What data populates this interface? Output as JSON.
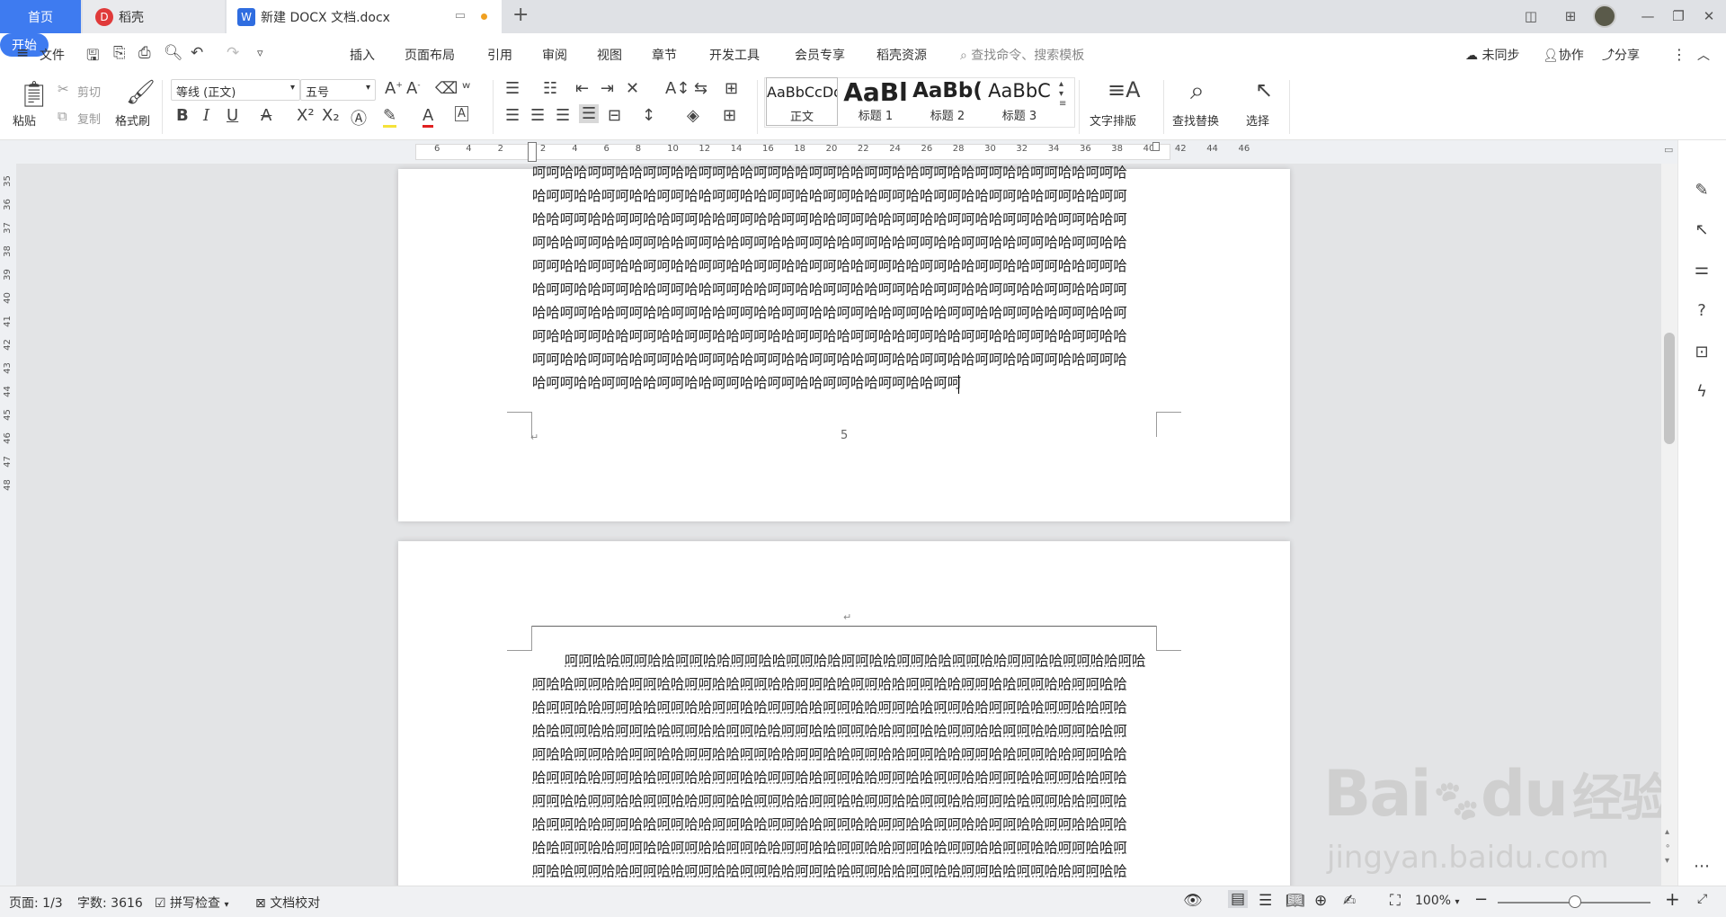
{
  "tabs": {
    "home": "首页",
    "daoke": "稻壳",
    "doc": "新建 DOCX 文档.docx",
    "add": "+"
  },
  "menu": {
    "file": "文件",
    "items": [
      "开始",
      "插入",
      "页面布局",
      "引用",
      "审阅",
      "视图",
      "章节",
      "开发工具",
      "会员专享",
      "稻壳资源"
    ],
    "search_placeholder": "查找命令、搜索模板",
    "sync": "未同步",
    "collab": "协作",
    "share": "分享"
  },
  "ribbon": {
    "paste": "粘贴",
    "cut": "剪切",
    "copy": "复制",
    "format_painter": "格式刷",
    "font_name": "等线 (正文)",
    "font_size": "五号",
    "styles": [
      {
        "preview": "AaBbCcDd",
        "name": "正文"
      },
      {
        "preview": "AaBl",
        "name": "标题 1"
      },
      {
        "preview": "AaBb(",
        "name": "标题 2"
      },
      {
        "preview": "AaBbC",
        "name": "标题 3"
      }
    ],
    "text_layout": "文字排版",
    "find_replace": "查找替换",
    "select": "选择"
  },
  "ruler": {
    "h_numbers": [
      "6",
      "4",
      "2",
      "2",
      "4",
      "6",
      "8",
      "10",
      "12",
      "14",
      "16",
      "18",
      "20",
      "22",
      "24",
      "26",
      "28",
      "30",
      "32",
      "34",
      "36",
      "38",
      "40",
      "42",
      "44",
      "46"
    ],
    "v_numbers": [
      "35",
      "36",
      "37",
      "38",
      "39",
      "40",
      "41",
      "42",
      "43",
      "44",
      "45",
      "46",
      "47",
      "48"
    ]
  },
  "page1": {
    "lines": [
      "呵呵哈哈呵呵哈哈呵呵哈哈呵呵哈哈呵呵哈哈呵呵哈哈呵呵哈哈呵呵哈哈呵呵哈哈呵呵哈哈呵呵哈",
      "哈呵呵哈哈呵呵哈哈呵呵哈哈呵呵哈哈呵呵哈哈呵呵哈哈呵呵哈哈呵呵哈哈呵呵哈哈呵呵哈哈呵呵",
      "哈哈呵呵哈哈呵呵哈哈呵呵哈哈呵呵哈哈呵呵哈哈呵呵哈哈呵呵哈哈呵呵哈哈呵呵哈哈呵呵哈哈呵",
      "呵哈哈呵呵哈哈呵呵哈哈呵呵哈哈呵呵哈哈呵呵哈哈呵呵哈哈呵呵哈哈呵呵哈哈呵呵哈哈呵呵哈哈",
      "呵呵哈哈呵呵哈哈呵呵哈哈呵呵哈哈呵呵哈哈呵呵哈哈呵呵哈哈呵呵哈哈呵呵哈哈呵呵哈哈呵呵哈",
      "哈呵呵哈哈呵呵哈哈呵呵哈哈呵呵哈哈呵呵哈哈呵呵哈哈呵呵哈哈呵呵哈哈呵呵哈哈呵呵哈哈呵呵",
      "哈哈呵呵哈哈呵呵哈哈呵呵哈哈呵呵哈哈呵呵哈哈呵呵哈哈呵呵哈哈呵呵哈哈呵呵哈哈呵呵哈哈呵",
      "呵哈哈呵呵哈哈呵呵哈哈呵呵哈哈呵呵哈哈呵呵哈哈呵呵哈哈呵呵哈哈呵呵哈哈呵呵哈哈呵呵哈哈",
      "呵呵哈哈呵呵哈哈呵呵哈哈呵呵哈哈呵呵哈哈呵呵哈哈呵呵哈哈呵呵哈哈呵呵哈哈呵呵哈哈呵呵哈",
      "哈呵呵哈哈呵呵哈哈呵呵哈哈呵呵哈哈呵呵哈哈呵呵哈哈呵呵哈哈呵呵"
    ],
    "page_number": "5"
  },
  "page2": {
    "lines": [
      "呵呵哈哈呵呵哈哈呵呵哈哈呵呵哈哈呵呵哈哈呵呵哈哈呵呵哈哈呵呵哈哈呵呵哈哈呵呵哈哈呵哈",
      "呵哈哈呵呵哈哈呵呵哈哈呵呵哈哈呵呵哈哈呵呵哈哈呵呵哈哈呵呵哈哈呵呵哈哈呵呵哈哈呵呵哈哈",
      "哈呵呵哈哈呵呵哈哈呵呵哈哈呵呵哈哈呵呵哈哈呵呵哈哈呵呵哈哈呵呵哈哈呵呵哈哈呵呵哈哈呵哈",
      "哈哈呵呵哈哈呵呵哈哈呵呵哈哈呵呵哈哈呵呵哈哈呵呵哈哈呵呵哈哈呵呵哈哈呵呵哈哈呵呵哈哈呵",
      "呵哈哈呵呵哈哈呵呵哈哈呵呵哈哈呵呵哈哈呵呵哈哈呵呵哈哈呵呵哈哈呵呵哈哈呵呵哈哈呵呵哈哈",
      "哈呵呵哈哈呵呵哈哈呵呵哈哈呵呵哈哈呵呵哈哈呵呵哈哈呵呵哈哈呵呵哈哈呵呵哈哈呵呵哈哈呵哈",
      "呵呵哈哈呵呵哈哈呵呵哈哈呵呵哈哈呵呵哈哈呵呵哈哈呵呵哈哈呵呵哈哈呵呵哈哈呵呵哈哈呵呵哈",
      "哈呵呵哈哈呵呵哈哈呵呵哈哈呵呵哈哈呵呵哈哈呵呵哈哈呵呵哈哈呵呵哈哈呵呵哈哈呵呵哈哈呵哈",
      "哈哈呵呵哈哈呵呵哈哈呵呵哈哈呵呵哈哈呵呵哈哈呵呵哈哈呵呵哈哈呵呵哈哈呵呵哈哈呵呵哈哈呵",
      "呵哈哈呵呵哈哈呵呵哈哈呵呵哈哈呵呵哈哈呵呵哈哈呵呵哈哈呵呵哈哈呵呵哈哈呵呵哈哈呵呵哈哈"
    ]
  },
  "status": {
    "page": "页面: 1/3",
    "word_count": "字数: 3616",
    "spell_check": "拼写检查",
    "doc_proof": "文档校对",
    "zoom": "100%"
  },
  "watermark": {
    "brand": "Bai",
    "brand2": "du",
    "cn": "经验",
    "url": "jingyan.baidu.com"
  }
}
